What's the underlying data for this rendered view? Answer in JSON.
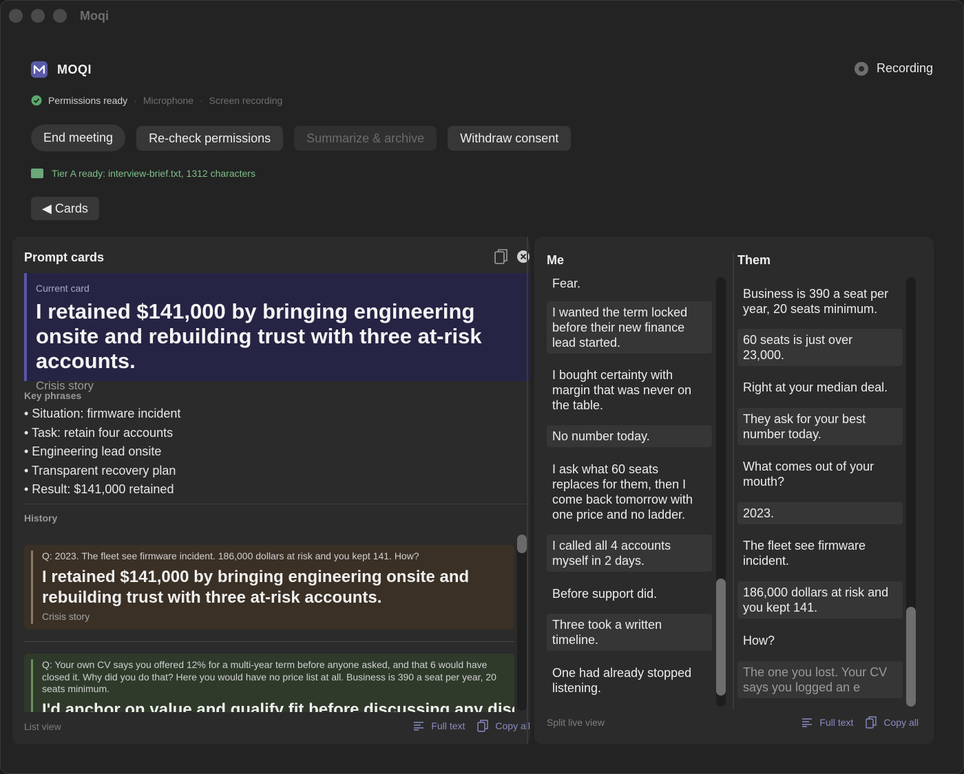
{
  "window": {
    "title": "Moqi"
  },
  "header": {
    "brand": "MOQI",
    "recording_label": "Recording"
  },
  "permissions": {
    "status": "Permissions ready",
    "items": [
      "Microphone",
      "Screen recording"
    ]
  },
  "actions": {
    "end_meeting": "End meeting",
    "recheck": "Re-check permissions",
    "summarize": "Summarize & archive",
    "withdraw": "Withdraw consent"
  },
  "tier_status": "Tier A ready: interview-brief.txt, 1312 characters",
  "cards_toggle": "◀ Cards",
  "prompt_cards": {
    "title": "Prompt cards",
    "current": {
      "label": "Current card",
      "text": "I retained $141,000 by bringing engineering onsite and rebuilding trust with three at-risk accounts.",
      "category": "Crisis story"
    },
    "key_phrases_title": "Key phrases",
    "key_phrases": [
      "• Situation: firmware incident",
      "• Task: retain four accounts",
      "• Engineering lead onsite",
      "• Transparent recovery plan",
      "• Result: $141,000 retained"
    ],
    "history_title": "History",
    "history": [
      {
        "question": "Q: 2023.  The fleet see firmware incident.  186,000 dollars at risk and you kept 141.  How?",
        "answer": "I retained $141,000 by bringing engineering onsite and rebuilding trust with three at-risk accounts.",
        "category": "Crisis story"
      },
      {
        "question": "Q: Your own CV says you offered 12% for a multi-year term before anyone asked, and that 6 would have closed it.  Why did you do that?  Here you would have no price list at all.  Business is 390 a seat per year, 20 seats minimum.",
        "answer": "I'd anchor on value and qualify fit before discussing any disc"
      }
    ],
    "footer_label": "List view",
    "full_text": "Full text",
    "copy_all": "Copy all"
  },
  "transcript": {
    "me_title": "Me",
    "them_title": "Them",
    "me": [
      "Fear.",
      "I wanted the term locked before their new finance lead started.",
      "I bought certainty with margin that was never on the table.",
      "No number today.",
      "I ask what 60 seats replaces for them, then I come back tomorrow with one price and no ladder.",
      "I called all 4 accounts myself in 2 days.",
      "Before support did.",
      "Three took a written timeline.",
      "One had already stopped listening."
    ],
    "them": [
      "Business is 390 a seat per year, 20 seats minimum.",
      "60 seats is just over 23,000.",
      "Right at your median deal.",
      "They ask for your best number today.",
      "What comes out of your mouth?",
      "2023.",
      "The fleet see firmware incident.",
      "186,000 dollars at risk and you kept 141.",
      "How?",
      "The one you lost. Your CV says you logged an e"
    ],
    "footer_label": "Split live view",
    "full_text": "Full text",
    "copy_all": "Copy all"
  },
  "colors": {
    "background": "#232323",
    "current_card": "#262444",
    "accent": "#5a56a8",
    "success": "#7fbf8a",
    "link": "#8b8bc4"
  }
}
